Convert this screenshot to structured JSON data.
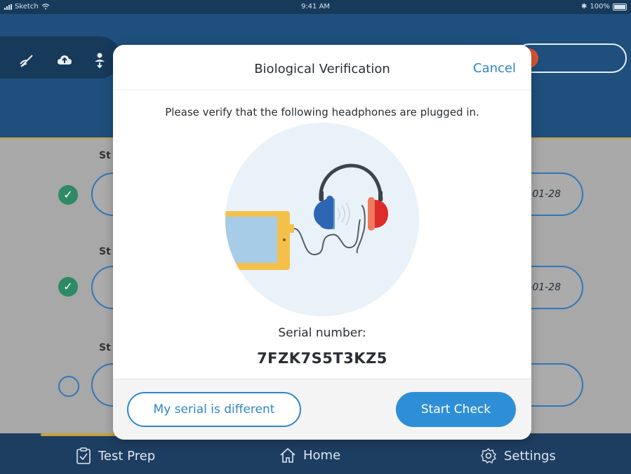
{
  "status_bar": {
    "carrier": "Sketch",
    "time": "9:41 AM",
    "battery": "100%"
  },
  "rows": [
    {
      "label": "St",
      "status": "complete",
      "date": "-01-28"
    },
    {
      "label": "St",
      "status": "complete",
      "date": "-01-28"
    },
    {
      "label": "St",
      "status": "incomplete",
      "date": ""
    }
  ],
  "modal": {
    "title": "Biological Verification",
    "cancel_label": "Cancel",
    "instruction": "Please verify that the following headphones are plugged in.",
    "serial_label": "Serial number:",
    "serial_value": "7FZK7S5T3KZ5",
    "secondary_button": "My serial is different",
    "primary_button": "Start Check"
  },
  "tabbar": {
    "tabs": [
      {
        "label": "Test Prep",
        "icon": "clipboard-check-icon"
      },
      {
        "label": "Home",
        "icon": "home-icon"
      },
      {
        "label": "Settings",
        "icon": "gear-icon"
      }
    ]
  },
  "colors": {
    "accent_blue": "#2f86c8",
    "header_navy": "#1e4f7d",
    "gold": "#c9a13a",
    "success_green": "#2e8a64",
    "status_red": "#d9532f"
  }
}
